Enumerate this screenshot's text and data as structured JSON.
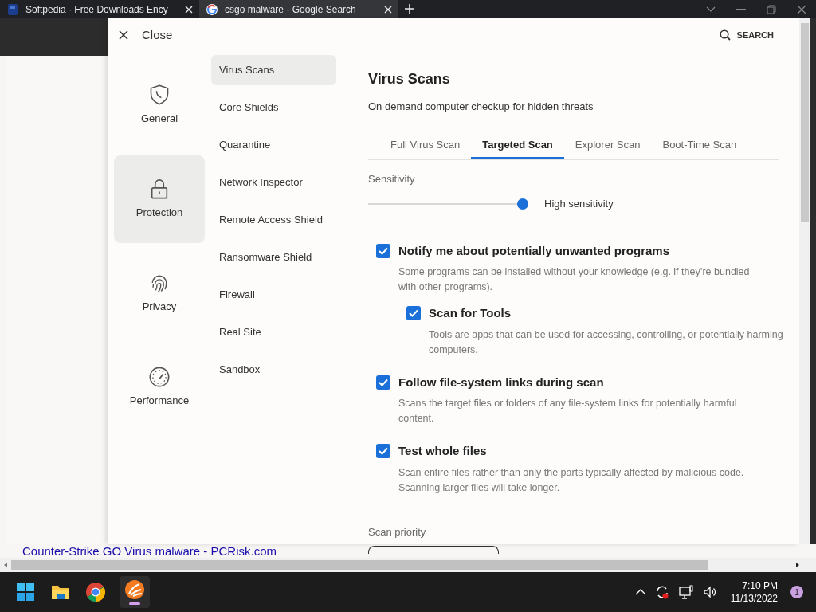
{
  "browser": {
    "tabs": [
      {
        "title": "Softpedia - Free Downloads Ency",
        "selected": false
      },
      {
        "title": "csgo malware - Google Search",
        "selected": true
      }
    ],
    "page_link": "Counter-Strike GO Virus malware - PCRisk.com"
  },
  "settings": {
    "close_label": "Close",
    "search_label": "SEARCH",
    "categories": [
      {
        "label": "General",
        "selected": false
      },
      {
        "label": "Protection",
        "selected": true
      },
      {
        "label": "Privacy",
        "selected": false
      },
      {
        "label": "Performance",
        "selected": false
      }
    ],
    "submenu": [
      {
        "label": "Virus Scans",
        "selected": true
      },
      {
        "label": "Core Shields",
        "selected": false
      },
      {
        "label": "Quarantine",
        "selected": false
      },
      {
        "label": "Network Inspector",
        "selected": false
      },
      {
        "label": "Remote Access Shield",
        "selected": false
      },
      {
        "label": "Ransomware Shield",
        "selected": false
      },
      {
        "label": "Firewall",
        "selected": false
      },
      {
        "label": "Real Site",
        "selected": false
      },
      {
        "label": "Sandbox",
        "selected": false
      }
    ],
    "content": {
      "title": "Virus Scans",
      "subtitle": "On demand computer checkup for hidden threats",
      "tabs": [
        {
          "label": "Full Virus Scan",
          "selected": false
        },
        {
          "label": "Targeted Scan",
          "selected": true
        },
        {
          "label": "Explorer Scan",
          "selected": false
        },
        {
          "label": "Boot-Time Scan",
          "selected": false
        }
      ],
      "sensitivity": {
        "label": "Sensitivity",
        "level": 1,
        "reading": "High sensitivity"
      },
      "options": [
        {
          "title": "Notify me about potentially unwanted programs",
          "description": "Some programs can be installed without your knowledge (e.g. if they’re bundled with other programs).",
          "checked": true,
          "children": [
            {
              "title": "Scan for Tools",
              "description": "Tools are apps that can be used for accessing, controlling, or potentially harming computers.",
              "checked": true
            }
          ]
        },
        {
          "title": "Follow file-system links during scan",
          "description": "Scans the target files or folders of any file-system links for potentially harmful content.",
          "checked": true
        },
        {
          "title": "Test whole files",
          "description": "Scan entire files rather than only the parts typically affected by malicious code. Scanning larger files will take longer.",
          "checked": true
        }
      ],
      "scan_priority_label": "Scan priority"
    }
  },
  "taskbar": {
    "time": "7:10 PM",
    "date": "11/13/2022",
    "notification_count": "1"
  }
}
